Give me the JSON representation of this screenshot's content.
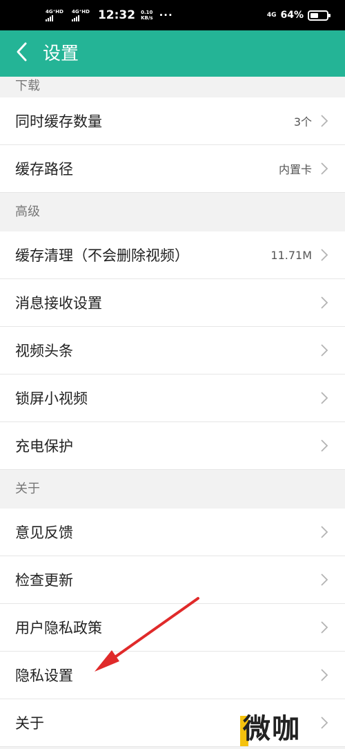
{
  "status_bar": {
    "sim1_label": "4G⁺HD",
    "sim2_label": "4G⁺HD",
    "time": "12:32",
    "speed_value": "0.10",
    "speed_unit": "KB/s",
    "more": "···",
    "network": "4G",
    "battery_percent": "64%",
    "battery_level": 0.64
  },
  "header": {
    "back_icon": "chevron-left-icon",
    "title": "设置"
  },
  "sections": [
    {
      "title": "下载",
      "items": [
        {
          "label": "同时缓存数量",
          "value": "3个"
        },
        {
          "label": "缓存路径",
          "value": "内置卡"
        }
      ]
    },
    {
      "title": "高级",
      "items": [
        {
          "label": "缓存清理（不会删除视频）",
          "value": "11.71M"
        },
        {
          "label": "消息接收设置",
          "value": ""
        },
        {
          "label": "视频头条",
          "value": ""
        },
        {
          "label": "锁屏小视频",
          "value": ""
        },
        {
          "label": "充电保护",
          "value": ""
        }
      ]
    },
    {
      "title": "关于",
      "items": [
        {
          "label": "意见反馈",
          "value": ""
        },
        {
          "label": "检查更新",
          "value": ""
        },
        {
          "label": "用户隐私政策",
          "value": ""
        },
        {
          "label": "隐私设置",
          "value": ""
        },
        {
          "label": "关于",
          "value": ""
        }
      ]
    }
  ],
  "watermark": {
    "text": "微咖"
  },
  "colors": {
    "accent": "#24b496",
    "annotation_arrow": "#e02a2a",
    "chevron": "#b3b3b3"
  }
}
